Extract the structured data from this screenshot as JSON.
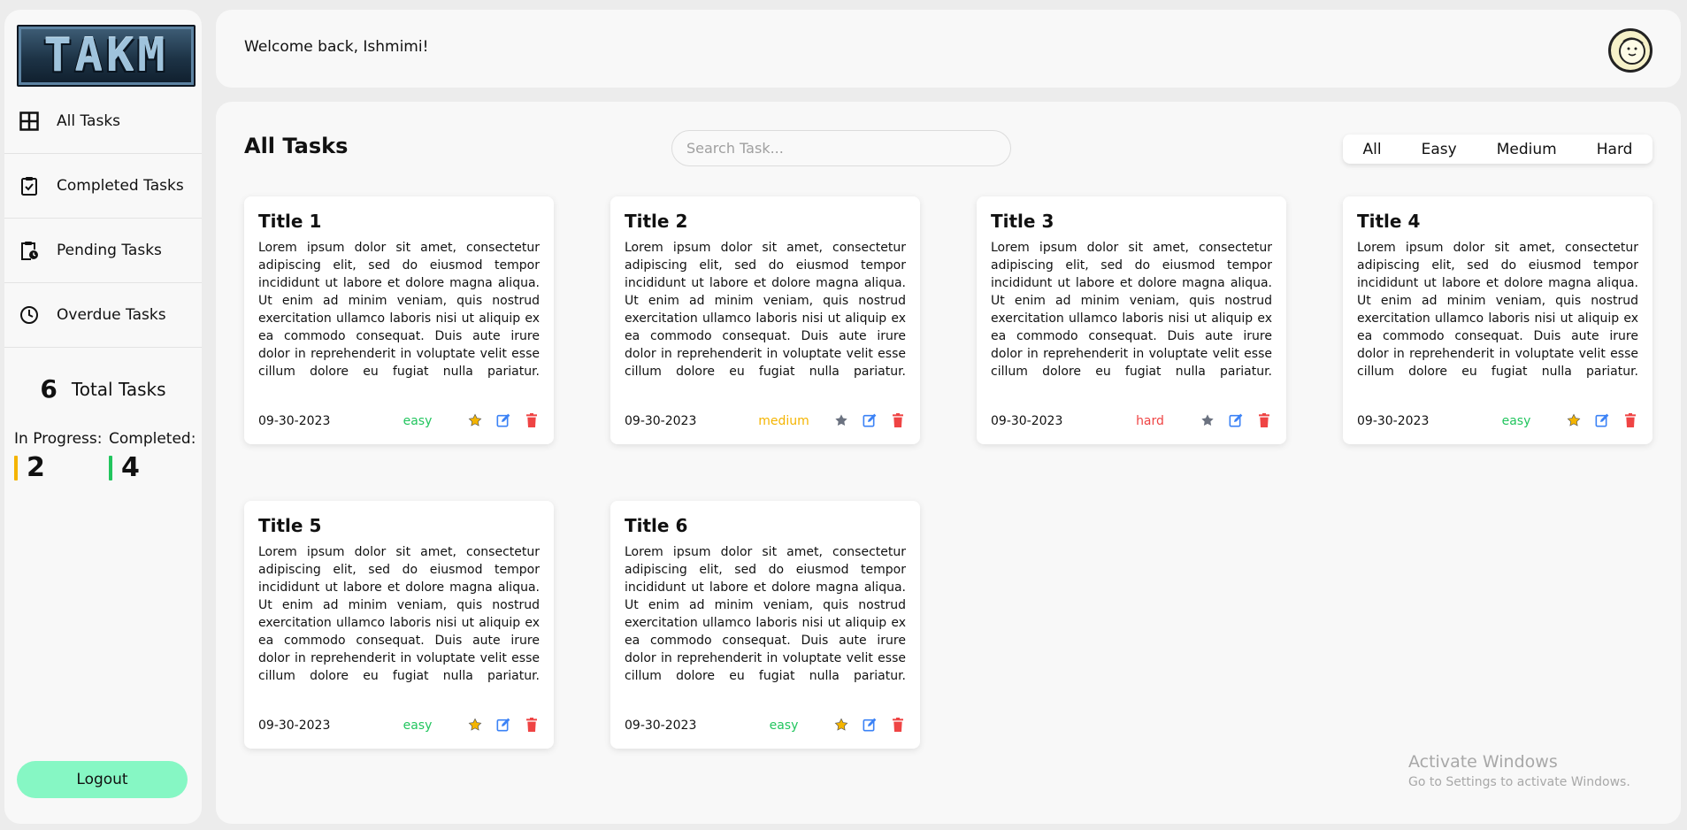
{
  "brand": {
    "logo_text": "TAKM"
  },
  "sidebar": {
    "items": [
      {
        "label": "All Tasks",
        "icon": "grid-icon"
      },
      {
        "label": "Completed Tasks",
        "icon": "clipboard-check-icon"
      },
      {
        "label": "Pending Tasks",
        "icon": "clipboard-clock-icon"
      },
      {
        "label": "Overdue Tasks",
        "icon": "clock-icon"
      }
    ],
    "total": {
      "count": "6",
      "label": "Total Tasks"
    },
    "in_progress": {
      "label": "In Progress:",
      "count": "2",
      "color": "#f4b400"
    },
    "completed": {
      "label": "Completed:",
      "count": "4",
      "color": "#22c55e"
    },
    "logout_label": "Logout"
  },
  "header": {
    "welcome": "Welcome back, Ishmimi!",
    "avatar": "avatar-icon"
  },
  "main": {
    "title": "All Tasks",
    "search": {
      "placeholder": "Search Task...",
      "value": ""
    },
    "filters": [
      "All",
      "Easy",
      "Medium",
      "Hard"
    ],
    "tasks": [
      {
        "title": "Title 1",
        "description": "Lorem ipsum dolor sit amet, consectetur adipiscing elit, sed do eiusmod tempor incididunt ut labore et dolore magna aliqua. Ut enim ad minim veniam, quis nostrud exercitation ullamco laboris nisi ut aliquip ex ea commodo consequat. Duis aute irure dolor in reprehenderit in voluptate velit esse cillum dolore eu fugiat nulla pariatur. Excepteur sint occaecat cupidatat non",
        "date": "09-30-2023",
        "difficulty": "easy",
        "difficulty_color": "#22c55e",
        "starred": true
      },
      {
        "title": "Title 2",
        "description": "Lorem ipsum dolor sit amet, consectetur adipiscing elit, sed do eiusmod tempor incididunt ut labore et dolore magna aliqua. Ut enim ad minim veniam, quis nostrud exercitation ullamco laboris nisi ut aliquip ex ea commodo consequat. Duis aute irure dolor in reprehenderit in voluptate velit esse cillum dolore eu fugiat nulla pariatur. Excepteur sint occaecat cupidatat non",
        "date": "09-30-2023",
        "difficulty": "medium",
        "difficulty_color": "#f4b400",
        "starred": false
      },
      {
        "title": "Title 3",
        "description": "Lorem ipsum dolor sit amet, consectetur adipiscing elit, sed do eiusmod tempor incididunt ut labore et dolore magna aliqua. Ut enim ad minim veniam, quis nostrud exercitation ullamco laboris nisi ut aliquip ex ea commodo consequat. Duis aute irure dolor in reprehenderit in voluptate velit esse cillum dolore eu fugiat nulla pariatur. Excepteur sint occaecat cupidatat non",
        "date": "09-30-2023",
        "difficulty": "hard",
        "difficulty_color": "#ef4444",
        "starred": false
      },
      {
        "title": "Title 4",
        "description": "Lorem ipsum dolor sit amet, consectetur adipiscing elit, sed do eiusmod tempor incididunt ut labore et dolore magna aliqua. Ut enim ad minim veniam, quis nostrud exercitation ullamco laboris nisi ut aliquip ex ea commodo consequat. Duis aute irure dolor in reprehenderit in voluptate velit esse cillum dolore eu fugiat nulla pariatur. Excepteur sint occaecat cupidatat non",
        "date": "09-30-2023",
        "difficulty": "easy",
        "difficulty_color": "#22c55e",
        "starred": true
      },
      {
        "title": "Title 5",
        "description": "Lorem ipsum dolor sit amet, consectetur adipiscing elit, sed do eiusmod tempor incididunt ut labore et dolore magna aliqua. Ut enim ad minim veniam, quis nostrud exercitation ullamco laboris nisi ut aliquip ex ea commodo consequat. Duis aute irure dolor in reprehenderit in voluptate velit esse cillum dolore eu fugiat nulla pariatur. Excepteur sint occaecat cupidatat non",
        "date": "09-30-2023",
        "difficulty": "easy",
        "difficulty_color": "#22c55e",
        "starred": true
      },
      {
        "title": "Title 6",
        "description": "Lorem ipsum dolor sit amet, consectetur adipiscing elit, sed do eiusmod tempor incididunt ut labore et dolore magna aliqua. Ut enim ad minim veniam, quis nostrud exercitation ullamco laboris nisi ut aliquip ex ea commodo consequat. Duis aute irure dolor in reprehenderit in voluptate velit esse cillum dolore eu fugiat nulla pariatur. Excepteur sint occaecat cupidatat non",
        "date": "09-30-2023",
        "difficulty": "easy",
        "difficulty_color": "#22c55e",
        "starred": true
      }
    ]
  },
  "watermark": {
    "line1": "Activate Windows",
    "line2": "Go to Settings to activate Windows."
  },
  "colors": {
    "star_on": "#f4b400",
    "star_off": "#6b7280",
    "edit": "#3b82f6",
    "delete": "#ef4444",
    "logout_bg": "#86f7c4"
  }
}
